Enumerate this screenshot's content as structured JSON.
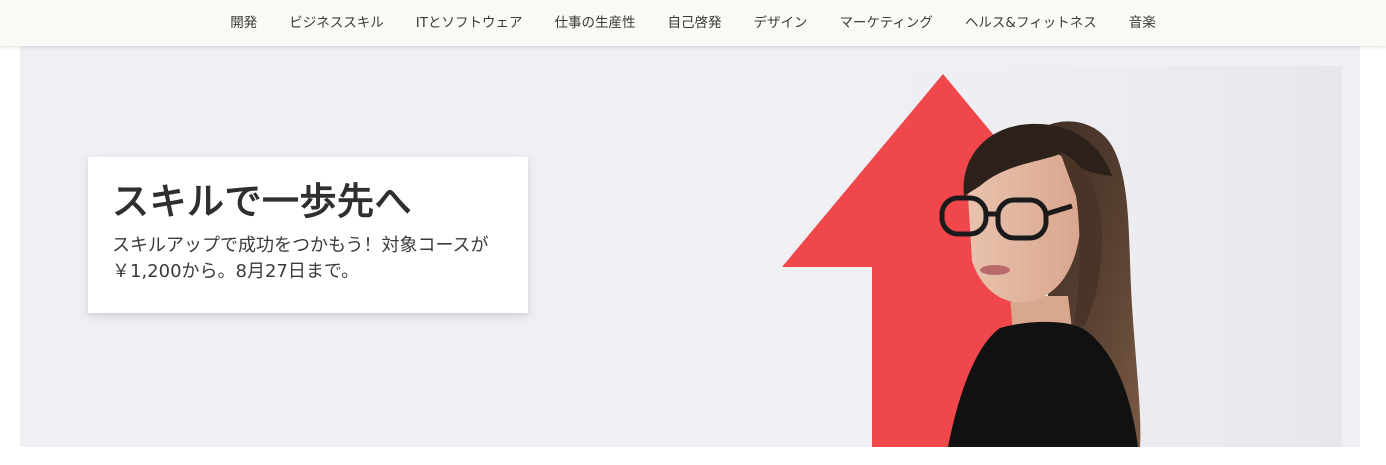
{
  "nav": {
    "items": [
      {
        "label": "開発"
      },
      {
        "label": "ビジネススキル"
      },
      {
        "label": "ITとソフトウェア"
      },
      {
        "label": "仕事の生産性"
      },
      {
        "label": "自己啓発"
      },
      {
        "label": "デザイン"
      },
      {
        "label": "マーケティング"
      },
      {
        "label": "ヘルス&フィットネス"
      },
      {
        "label": "音楽"
      }
    ]
  },
  "hero": {
    "title": "スキルで一歩先へ",
    "text": "スキルアップで成功をつかもう！対象コースが￥1,200から。8月27日まで。",
    "background_color": "#efeff4",
    "arrow_color": "#ef474b"
  }
}
